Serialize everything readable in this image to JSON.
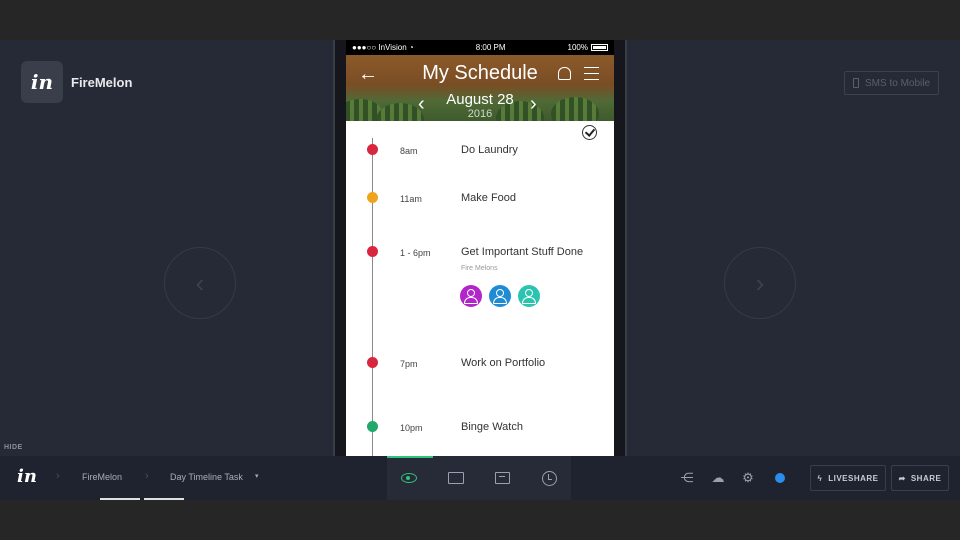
{
  "project": {
    "logo_text": "in",
    "name": "FireMelon"
  },
  "sms_button": {
    "label": "SMS to Mobile"
  },
  "hide_label": "HIDE",
  "phone": {
    "status": {
      "carrier": "●●●○○ InVision ◔",
      "time": "8:00 PM",
      "battery": "100%"
    },
    "header": {
      "title": "My Schedule",
      "date": "August 28",
      "year": "2016"
    },
    "timeline": [
      {
        "time": "8am",
        "task": "Do Laundry",
        "color": "#d7263d"
      },
      {
        "time": "11am",
        "task": "Make Food",
        "color": "#f0a41c"
      },
      {
        "time": "1 - 6pm",
        "task": "Get Important Stuff Done",
        "subtitle": "Fire Melons",
        "color": "#d7263d",
        "avatars": [
          "#b026c9",
          "#1f8bd2",
          "#2ac4b0"
        ]
      },
      {
        "time": "7pm",
        "task": "Work on Portfolio",
        "color": "#d7263d"
      },
      {
        "time": "10pm",
        "task": "Binge Watch",
        "color": "#22a86b"
      }
    ]
  },
  "toolbar": {
    "logo": "in",
    "breadcrumb_project": "FireMelon",
    "breadcrumb_screen": "Day Timeline Task",
    "liveshare_label": "LIVESHARE",
    "share_label": "SHARE",
    "accent": "#2fc37b"
  }
}
